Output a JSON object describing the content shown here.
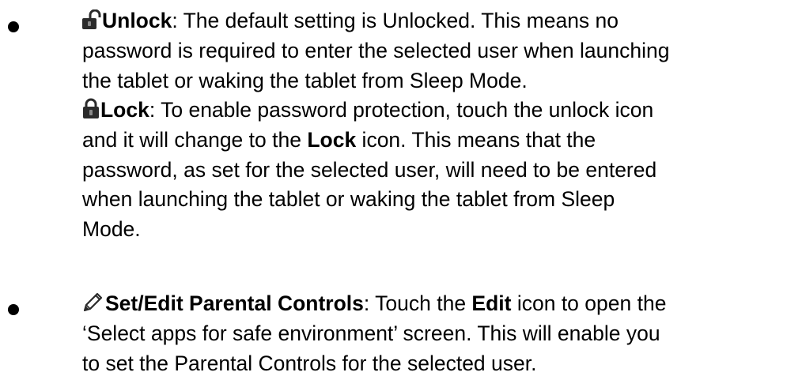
{
  "items": [
    {
      "icon": "unlock-icon",
      "term": "Unlock",
      "line1_rest": ": The default setting is Unlocked. This means no",
      "line2": "password is required to enter the selected user when launching",
      "line3": "the tablet or waking the tablet from Sleep Mode."
    },
    {
      "icon": "lock-icon",
      "term": "Lock",
      "line1_rest": ": To enable password protection, touch the unlock icon",
      "line2_pre": "and it will change to the ",
      "line2_bold": "Lock",
      "line2_post": " icon. This means that the",
      "line3": "password, as set for the selected user, will need to be entered",
      "line4": "when launching the tablet or waking the tablet from Sleep",
      "line5": "Mode."
    },
    {
      "icon": "pencil-icon",
      "term": "Set/Edit Parental Controls",
      "line1_mid": ": Touch the ",
      "line1_bold": "Edit",
      "line1_post": " icon to open the",
      "line2": "‘Select apps for safe environment’ screen. This will enable you",
      "line3": "to set the Parental Controls for the selected user."
    }
  ]
}
